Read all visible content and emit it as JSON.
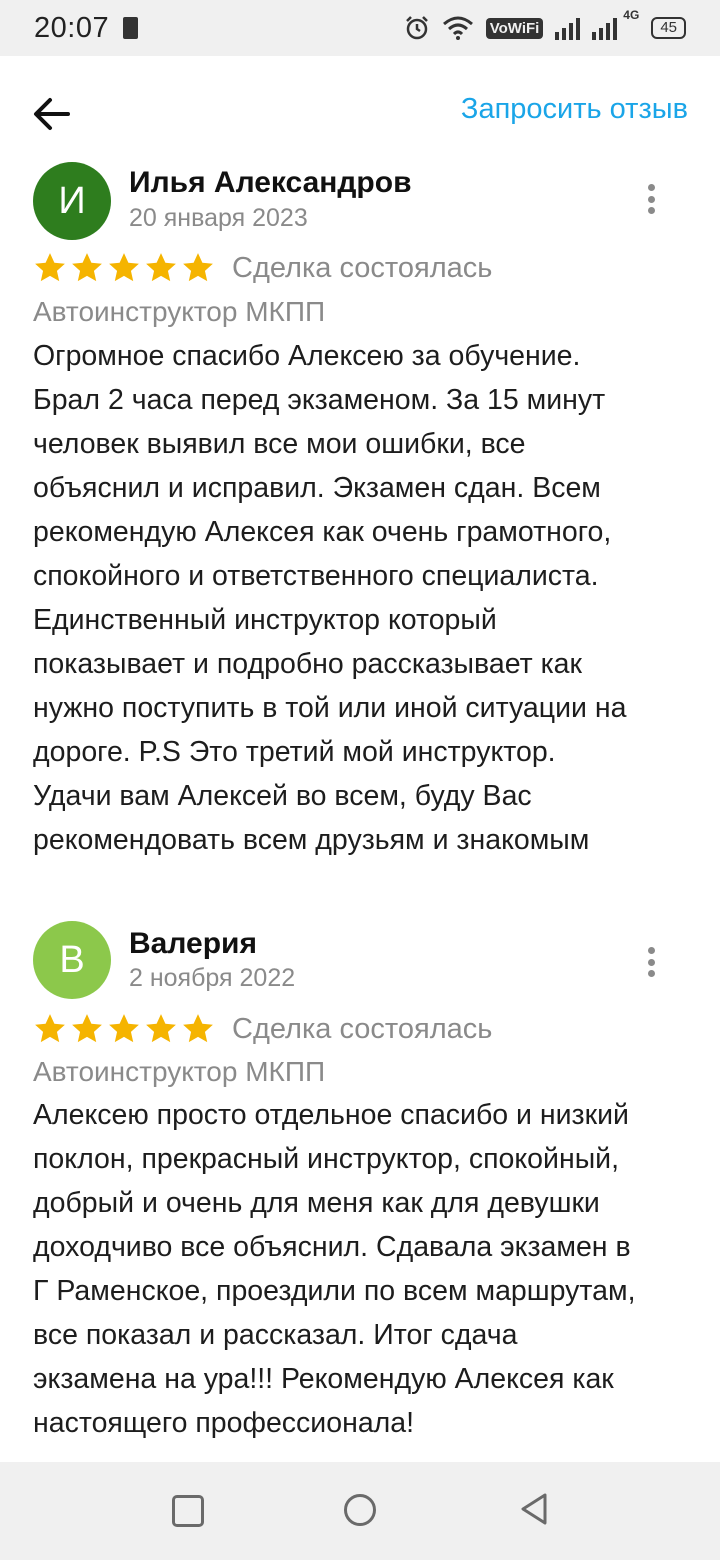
{
  "status_bar": {
    "time": "20:07",
    "vowifi": "VoWiFi",
    "network": "4G",
    "battery": "45"
  },
  "header": {
    "back_icon": "arrow-left-icon",
    "request_review_label": "Запросить отзыв"
  },
  "colors": {
    "accent": "#1aa5e8",
    "star": "#f5b400",
    "avatar_1": "#2e7d1e",
    "avatar_2": "#8cc84b"
  },
  "reviews": [
    {
      "avatar_letter": "И",
      "author": "Илья Александров",
      "date": "20 января 2023",
      "rating": 5,
      "deal_status": "Сделка состоялась",
      "category": "Автоинструктор МКПП",
      "lines": [
        "Огромное спасибо Алексею за обучение.",
        "Брал 2 часа перед экзаменом. За 15 минут",
        "человек выявил все мои ошибки, все",
        "объяснил и исправил. Экзамен сдан. Всем",
        "рекомендую Алексея как очень грамотного,",
        "спокойного и ответственного специалиста.",
        "Единственный инструктор который",
        "показывает и подробно рассказывает как",
        "нужно поступить в той или иной ситуации на",
        "дороге. P.S Это третий мой инструктор.",
        "Удачи вам Алексей во всем, буду Вас",
        "рекомендовать всем друзьям и знакомым"
      ]
    },
    {
      "avatar_letter": "В",
      "author": "Валерия",
      "date": "2 ноября 2022",
      "rating": 5,
      "deal_status": "Сделка состоялась",
      "category": "Автоинструктор МКПП",
      "lines": [
        "Алексею просто отдельное спасибо и низкий",
        "поклон, прекрасный инструктор, спокойный,",
        "добрый и очень для меня как для девушки",
        "доходчиво все объяснил. Сдавала экзамен в",
        "Г Раменское, проездили по всем маршрутам,",
        "все показал и рассказал. Итог сдача",
        "экзамена на ура!!! Рекомендую Алексея как",
        "настоящего профессионала!"
      ]
    }
  ]
}
